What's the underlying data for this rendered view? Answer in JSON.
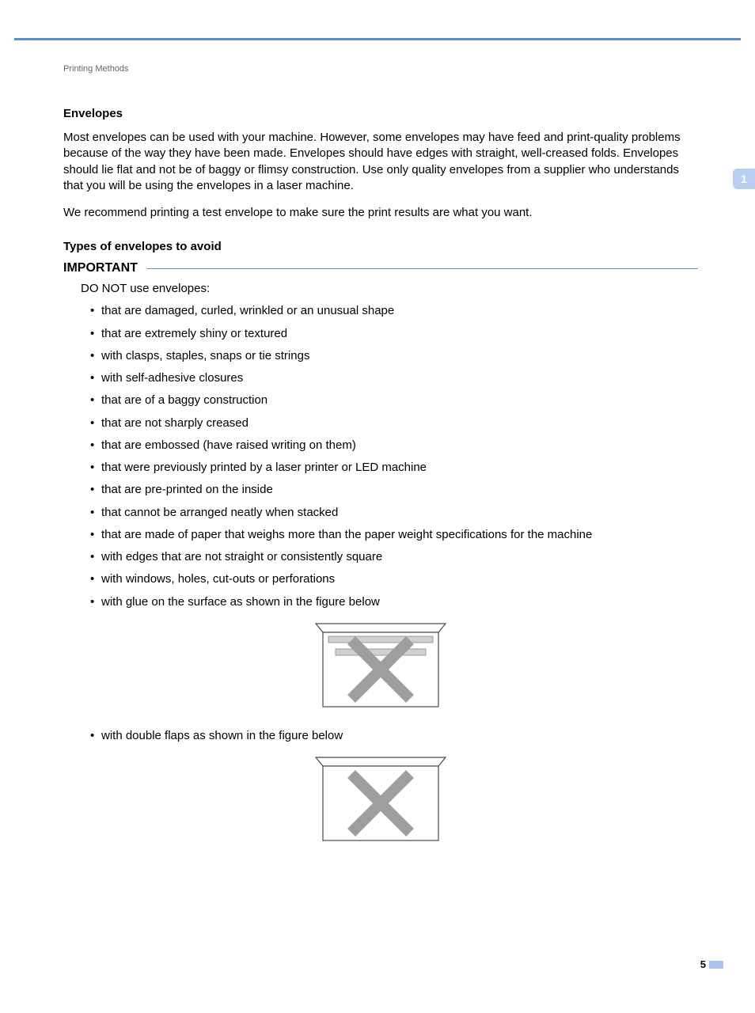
{
  "breadcrumb": "Printing Methods",
  "section1": {
    "heading": "Envelopes",
    "paragraph1": "Most envelopes can be used with your machine. However, some envelopes may have feed and print-quality problems because of the way they have been made. Envelopes should have edges with straight, well-creased folds. Envelopes should lie flat and not be of baggy or flimsy construction. Use only quality envelopes from a supplier who understands that you will be using the envelopes in a laser machine.",
    "paragraph2": "We recommend printing a test envelope to make sure the print results are what you want."
  },
  "section2": {
    "heading": "Types of envelopes to avoid",
    "important_label": "IMPORTANT",
    "intro": "DO NOT use envelopes:",
    "bullets_group1": [
      "that are damaged, curled, wrinkled or an unusual shape",
      "that are extremely shiny or textured",
      "with clasps, staples, snaps or tie strings",
      "with self-adhesive closures",
      "that are of a baggy construction",
      "that are not sharply creased",
      "that are embossed (have raised writing on them)",
      "that were previously printed by a laser printer or LED machine",
      "that are pre-printed on the inside",
      "that cannot be arranged neatly when stacked",
      "that are made of paper that weighs more than the paper weight specifications for the machine",
      "with edges that are not straight or consistently square",
      "with windows, holes, cut-outs or perforations",
      "with glue on the surface as shown in the figure below"
    ],
    "bullets_group2": [
      "with double flaps as shown in the figure below"
    ]
  },
  "tab_number": "1",
  "page_number": "5"
}
